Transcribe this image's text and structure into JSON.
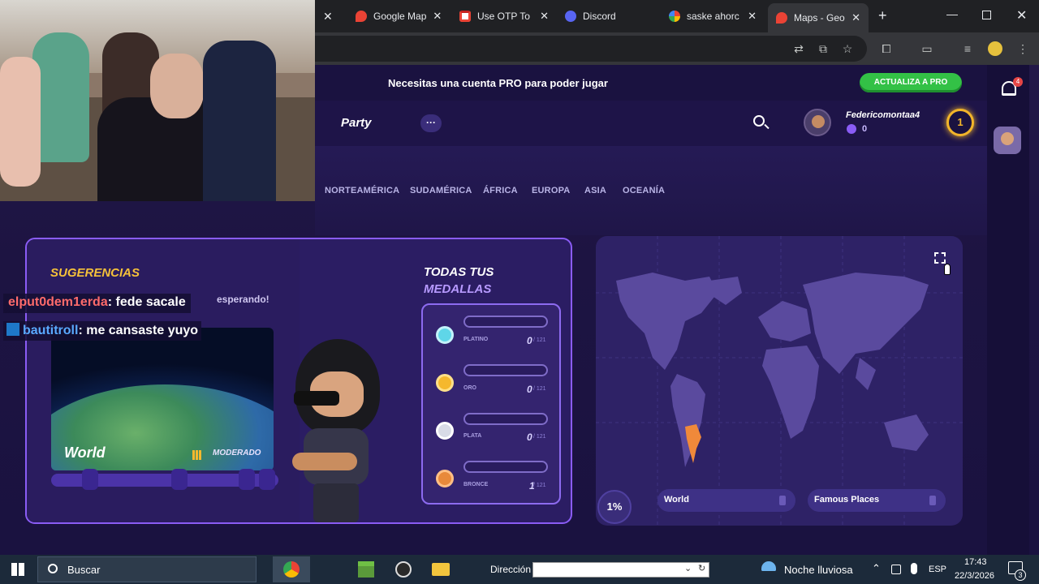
{
  "browser": {
    "tabs": [
      {
        "title": "Google Map",
        "favicon": "maps-pin-icon",
        "color": "#ea4335"
      },
      {
        "title": "Use OTP To",
        "favicon": "gmail-icon",
        "color": "#ea4335"
      },
      {
        "title": "Discord",
        "favicon": "discord-icon",
        "color": "#5865f2"
      },
      {
        "title": "saske ahorc",
        "favicon": "google-icon",
        "color": "#4285f4"
      },
      {
        "title": "Maps - Geo",
        "favicon": "maps-pin-icon",
        "color": "#ea4335"
      }
    ]
  },
  "promo": {
    "text": "Necesitas una cuenta PRO para poder jugar",
    "button": "ACTUALIZA A PRO"
  },
  "nav": {
    "party": "Party",
    "more": "···",
    "username": "Federicomontaa4",
    "coins": "0",
    "level": "1",
    "notifications": "4"
  },
  "regions": [
    "NORTEAMÉRICA",
    "SUDAMÉRICA",
    "ÁFRICA",
    "EUROPA",
    "ASIA",
    "OCEANÍA"
  ],
  "suggestions": {
    "title": "SUGERENCIAS",
    "subtitle": "esperando!",
    "map_name": "World",
    "difficulty": "MODERADO"
  },
  "chat": [
    {
      "user": "elput0dem1erda",
      "message": ": fede sacale",
      "user_color": "#ff6b6b"
    },
    {
      "user": "bautitroll",
      "message": ": me cansaste yuyo",
      "user_color": "#5aa9ff"
    }
  ],
  "medals": {
    "title_line1": "TODAS TUS",
    "title_line2": "MEDALLAS",
    "items": [
      {
        "name": "PLATINO",
        "count": "0",
        "total": "/ 121",
        "color": "#5fd6e8"
      },
      {
        "name": "ORO",
        "count": "0",
        "total": "/ 121",
        "color": "#f5b82e"
      },
      {
        "name": "PLATA",
        "count": "0",
        "total": "/ 121",
        "color": "#d8dbe6"
      },
      {
        "name": "BRONCE",
        "count": "1",
        "total": "/ 121",
        "color": "#e8893a"
      }
    ]
  },
  "map_panel": {
    "progress": "1%",
    "chips": [
      "World",
      "Famous Places"
    ]
  },
  "taskbar": {
    "search": "Buscar",
    "address_label": "Dirección",
    "weather": "Noche lluviosa",
    "lang": "ESP",
    "time": "17:43",
    "date": "22/3/2026",
    "notif_count": "3"
  },
  "colors": {
    "accent": "#8a5cf5",
    "pro_button": "#33c146",
    "suggestion_title": "#f5c13a",
    "highlight_country": "#f0893a"
  }
}
